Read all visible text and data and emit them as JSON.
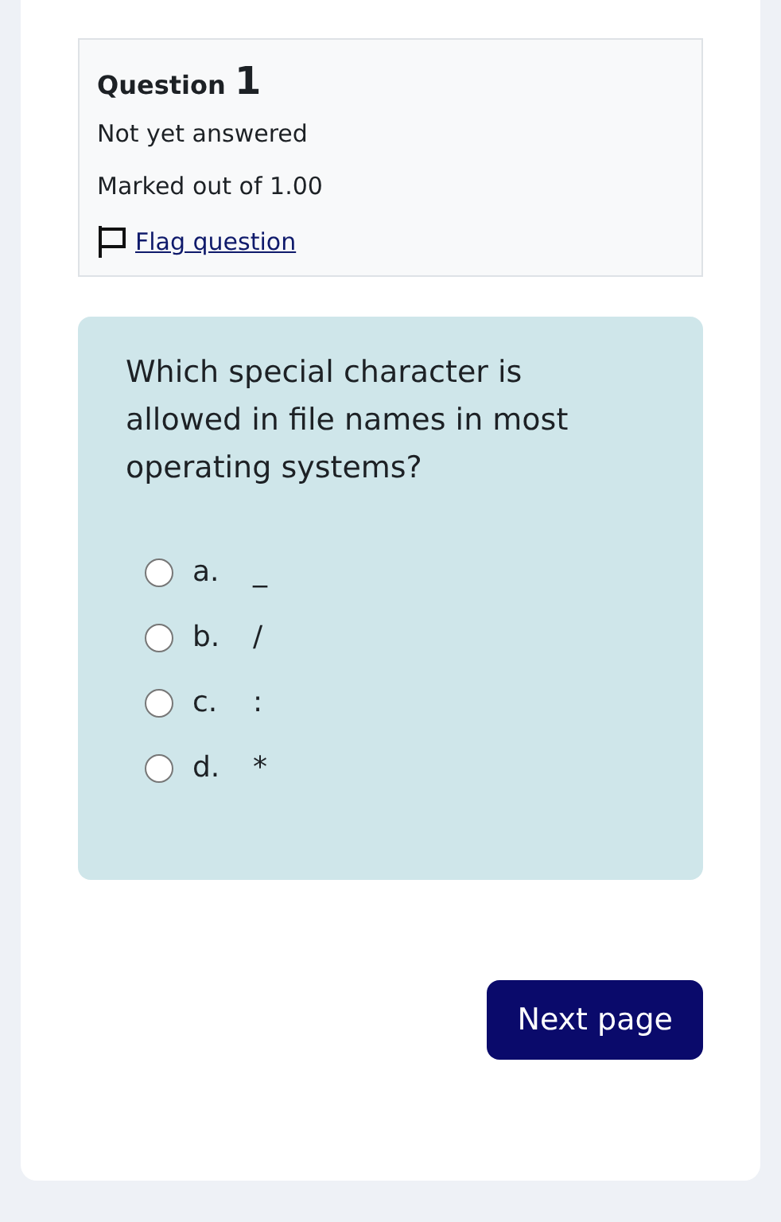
{
  "info": {
    "question_label": "Question",
    "question_number": "1",
    "status": "Not yet answered",
    "marks": "Marked out of 1.00",
    "flag_link": "Flag question",
    "flagged": false
  },
  "question": {
    "text": "Which special character is allowed in file names in most operating systems?",
    "options": [
      {
        "letter": "a.",
        "answer": "_",
        "selected": false
      },
      {
        "letter": "b.",
        "answer": "/",
        "selected": false
      },
      {
        "letter": "c.",
        "answer": ":",
        "selected": false
      },
      {
        "letter": "d.",
        "answer": "*",
        "selected": false
      }
    ]
  },
  "next_button": "Next page"
}
